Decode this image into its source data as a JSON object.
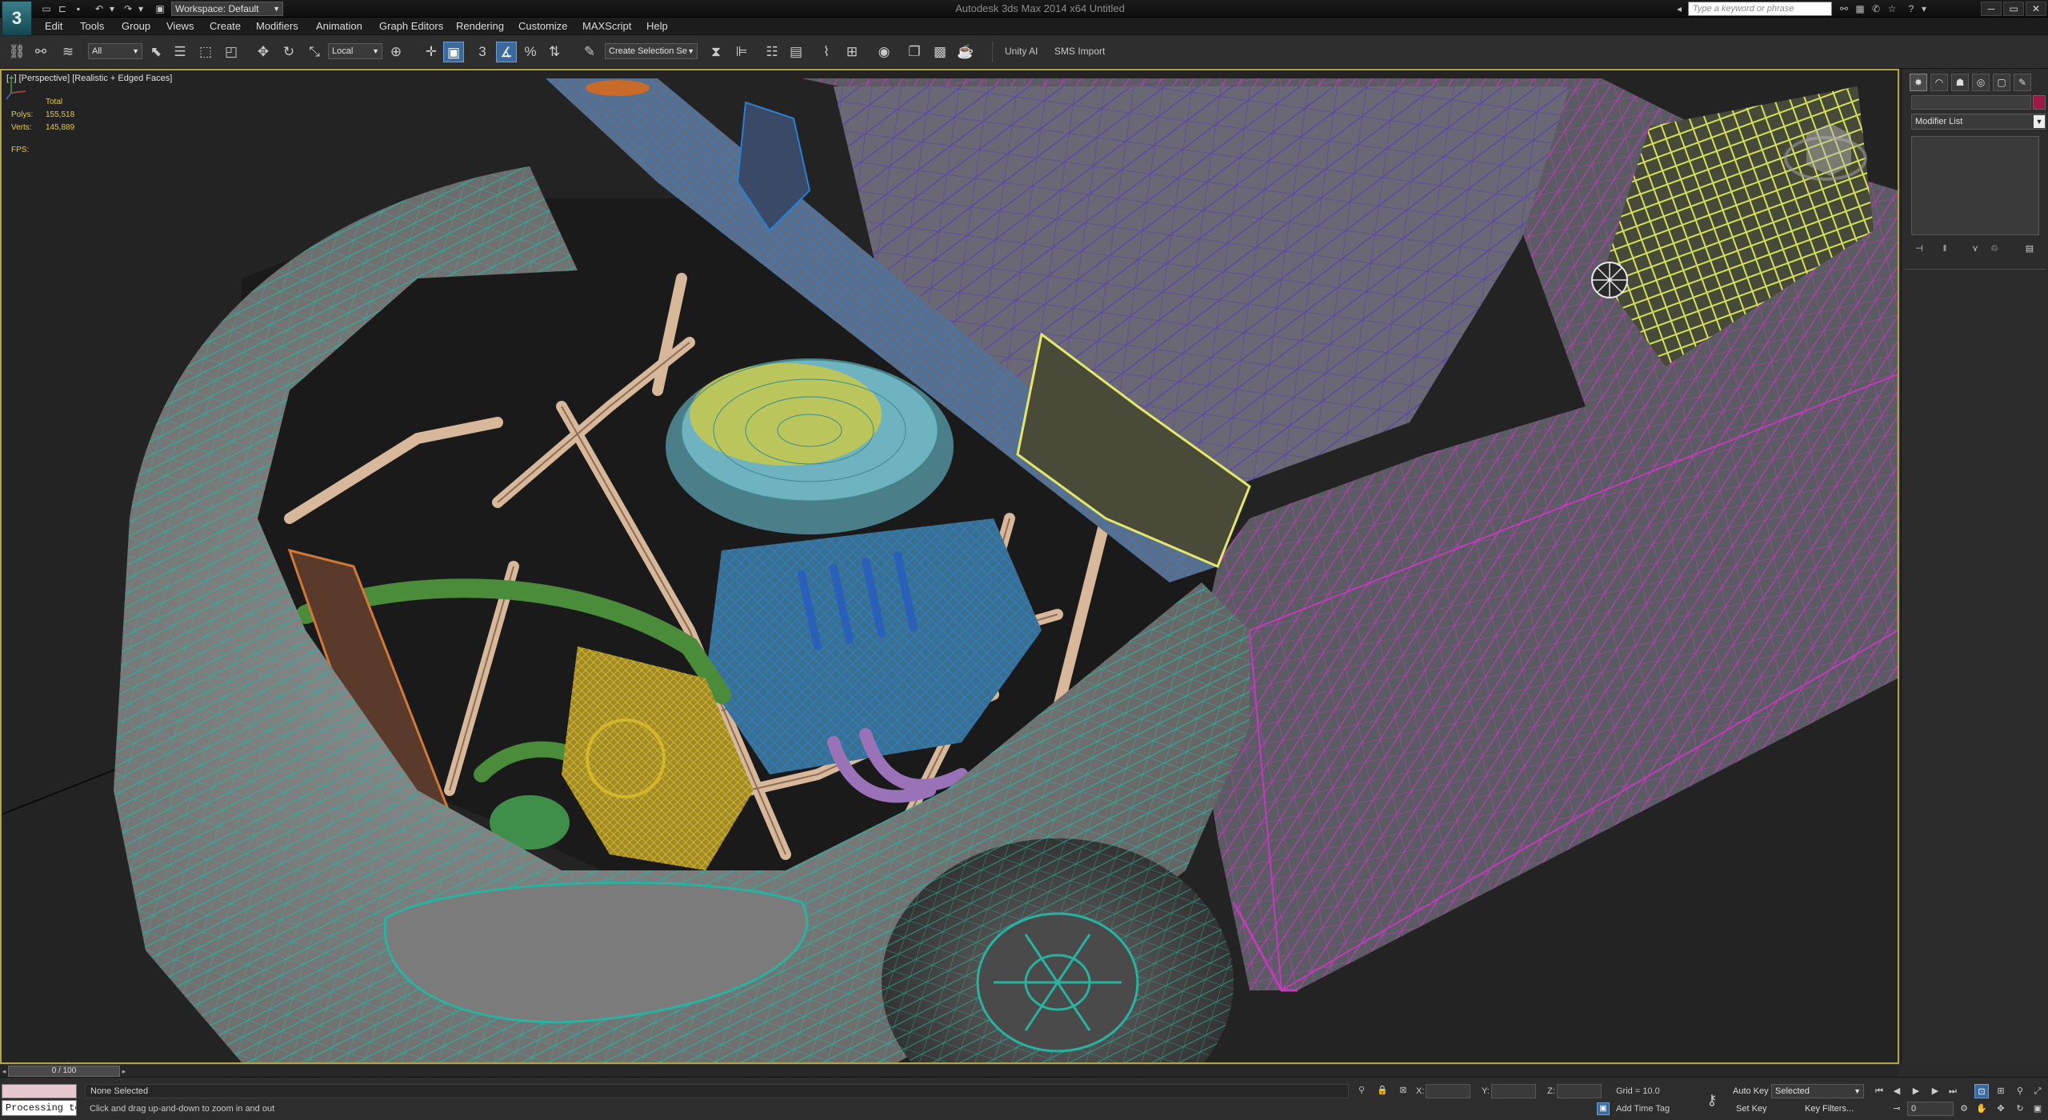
{
  "titlebar": {
    "workspace_label": "Workspace: Default",
    "window_title": "Autodesk 3ds Max 2014 x64     Untitled",
    "search_placeholder": "Type a keyword or phrase"
  },
  "menu": [
    "Edit",
    "Tools",
    "Group",
    "Views",
    "Create",
    "Modifiers",
    "Animation",
    "Graph Editors",
    "Rendering",
    "Customize",
    "MAXScript",
    "Help"
  ],
  "toolbar": {
    "selection_filter": "All",
    "coord_system": "Local",
    "named_selection": "Create Selection Se",
    "unity_label": "Unity AI",
    "sms_label": "SMS Import"
  },
  "viewport": {
    "label": "[+] [Perspective] [Realistic + Edged Faces]",
    "stats_header": "Total",
    "polys_label": "Polys:",
    "polys_value": "155,518",
    "verts_label": "Verts:",
    "verts_value": "145,889",
    "fps_label": "FPS:",
    "fps_value": ""
  },
  "command_panel": {
    "modifier_list": "Modifier List",
    "object_color": "#9e1a46"
  },
  "timeline": {
    "frame_display": "0 / 100"
  },
  "status": {
    "listener_text": "Processing to",
    "selection": "None Selected",
    "prompt": "Click and drag up-and-down to zoom in and out",
    "x_label": "X:",
    "y_label": "Y:",
    "z_label": "Z:",
    "grid": "Grid = 10.0",
    "add_time_tag": "Add Time Tag",
    "auto_key": "Auto Key",
    "set_key": "Set Key",
    "key_mode": "Selected",
    "key_filters": "Key Filters...",
    "frame": "0"
  },
  "colors": {
    "viewport_border": "#b5a24c",
    "body_wire": "#27b3a0",
    "roof_wire": "#c23bbb",
    "engine_wire": "#2c7fcc",
    "alternator_wire": "#d4b62a",
    "cage_wire": "#d7b89a"
  }
}
